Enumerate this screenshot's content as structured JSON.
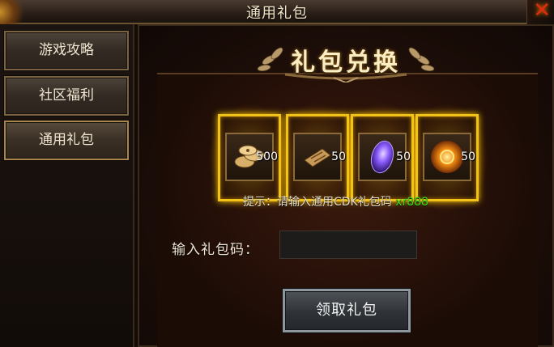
{
  "window": {
    "title": "通用礼包"
  },
  "sidebar": {
    "items": [
      {
        "label": "游戏攻略"
      },
      {
        "label": "社区福利"
      },
      {
        "label": "通用礼包"
      }
    ]
  },
  "panel": {
    "banner_title": "礼包兑换",
    "rewards": [
      {
        "icon": "coins-icon",
        "count": "500"
      },
      {
        "icon": "scroll-icon",
        "count": "50"
      },
      {
        "icon": "purple-gem-icon",
        "count": "50"
      },
      {
        "icon": "orange-orb-icon",
        "count": "50"
      }
    ],
    "hint_prefix": "提示：请输入通用CDK礼包码",
    "hint_code": "xr888",
    "input_label": "输入礼包码：",
    "input_value": "",
    "input_placeholder": "",
    "redeem_button": "领取礼包"
  },
  "colors": {
    "accent_gold": "#f2c21a",
    "hint_code": "#36e11a",
    "close_red": "#e02a10"
  }
}
